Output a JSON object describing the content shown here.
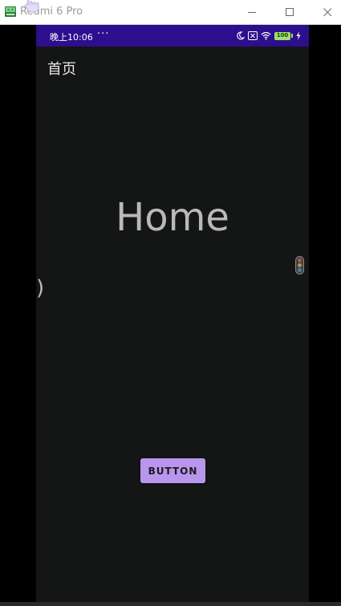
{
  "window": {
    "title": "Redmi 6 Pro",
    "icon": "android-emulator-icon",
    "controls": {
      "minimize": "minimize-icon",
      "maximize": "maximize-icon",
      "close": "close-icon"
    }
  },
  "statusbar": {
    "time": "晚上10:06",
    "more": "···",
    "icons": [
      "moon-icon",
      "sim-icon",
      "wifi-icon",
      "battery-icon",
      "charging-icon"
    ],
    "battery_level": "100",
    "background": "#2d0e8c"
  },
  "screen": {
    "page_title": "首页",
    "home_text": "Home",
    "side_handle": ")",
    "button_label": "BUTTON",
    "button_color": "#b896ec",
    "background": "#141515"
  }
}
